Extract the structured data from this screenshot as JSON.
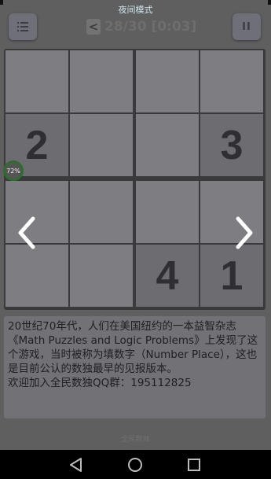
{
  "header": {
    "night_mode": "夜间模式",
    "back_glyph": "<",
    "level": "28/30 [0:03]",
    "pause_glyph": "II"
  },
  "board": {
    "cells": [
      [
        "",
        "",
        "",
        ""
      ],
      [
        "2",
        "",
        "",
        "3"
      ],
      [
        "",
        "",
        "",
        ""
      ],
      [
        "",
        "",
        "4",
        "1"
      ]
    ]
  },
  "progress": {
    "label": "72%",
    "value": 0.72
  },
  "description": {
    "paragraph": "20世纪70年代，人们在美国纽约的一本益智杂志《Math Puzzles and Logic Problems》上发现了这个游戏，当时被称为填数字（Number Place），这也是目前公认的数独最早的见报版本。",
    "qq": "欢迎加入全民数独QQ群：195112825"
  },
  "footer": {
    "text": "全民数独"
  },
  "colors": {
    "accent_green": "#2f6c2f",
    "night_label": "#cfe6ef"
  }
}
